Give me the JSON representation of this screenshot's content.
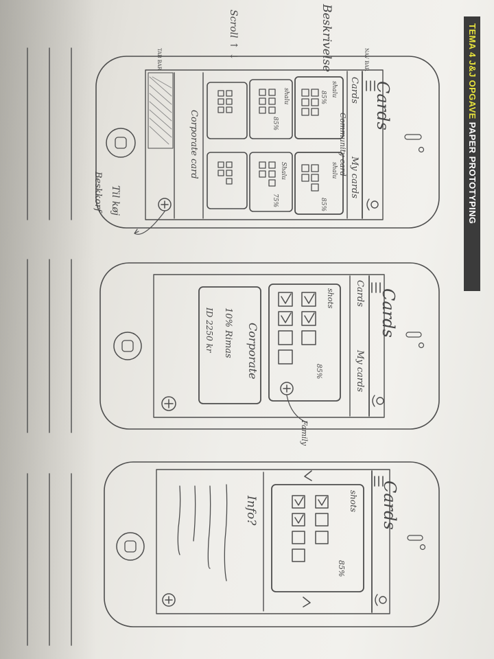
{
  "banner": {
    "highlight": "TEMA 4 J&J OPGAVE",
    "rest": "PAPER PROTOTYPING"
  },
  "notes": {
    "beskrivelse": "Beskrivelse",
    "scroll": "Scroll ↑ ↓",
    "tab_bar": "TAB BAR",
    "nav_bar": "NAV BAR",
    "til_koj": "Til køj",
    "fast_korf": "Beskkorf",
    "family": "Family"
  },
  "common": {
    "app_title": "Cards",
    "menu_icon": "hamburger-menu-icon",
    "profile_icon": "person-icon",
    "add_icon": "plus-circle-icon"
  },
  "screens": [
    {
      "segment_left": "Cards",
      "segment_right": "My cards",
      "cards": [
        {
          "title": "Community card",
          "name": "shalu",
          "badge": "85%"
        },
        {
          "title": "",
          "name": "shalu",
          "badge": "85%"
        },
        {
          "title": "",
          "name": "shalu",
          "badge": "85%"
        },
        {
          "title": "",
          "name": "Shalu",
          "badge": "75%"
        },
        {
          "title": "",
          "name": "",
          "badge": ""
        },
        {
          "title": "",
          "name": "",
          "badge": ""
        }
      ],
      "corporate": "Corporate card"
    },
    {
      "segment_left": "Cards",
      "segment_right": "My cards",
      "card": {
        "name": "shots",
        "badge": "85%"
      },
      "corporate": {
        "title": "Corporate",
        "line1": "10% Rimas",
        "line2": "ID 2250 kr"
      }
    },
    {
      "card": {
        "name": "shots",
        "badge": "85%"
      },
      "info": "Info?"
    }
  ]
}
